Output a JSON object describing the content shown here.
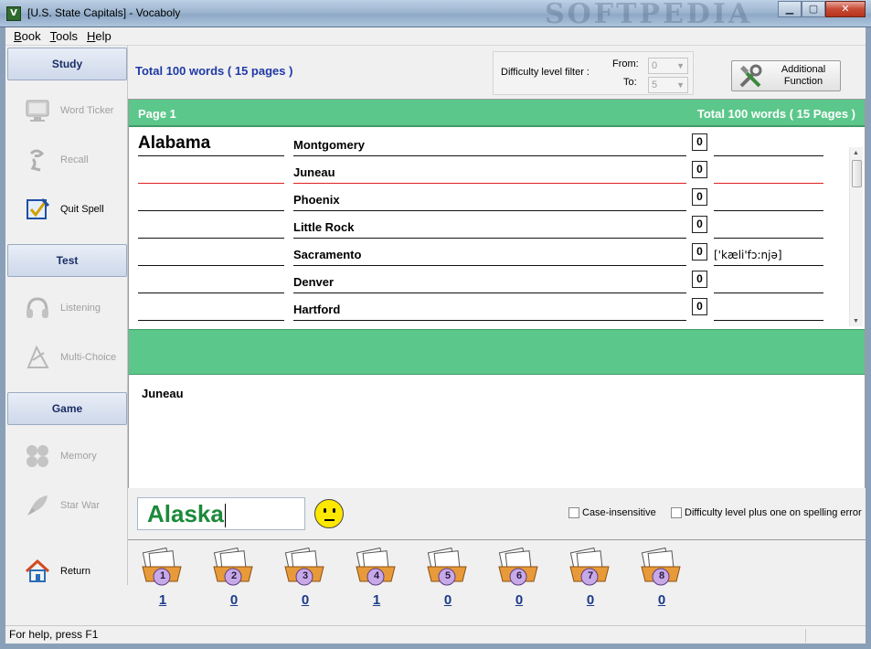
{
  "window": {
    "title": "[U.S. State Capitals] - Vocaboly",
    "watermark": "SOFTPEDIA",
    "controls": [
      "minimize",
      "maximize",
      "close"
    ]
  },
  "menu": [
    "Book",
    "Tools",
    "Help"
  ],
  "sidebar": {
    "study_header": "Study",
    "study_items": [
      {
        "label": "Word Ticker",
        "icon": "monitor-icon",
        "enabled": false
      },
      {
        "label": "Recall",
        "icon": "recall-icon",
        "enabled": false
      },
      {
        "label": "Quit Spell",
        "icon": "spell-icon",
        "enabled": true
      }
    ],
    "test_header": "Test",
    "test_items": [
      {
        "label": "Listening",
        "icon": "headphones-icon",
        "enabled": false
      },
      {
        "label": "Multi-Choice",
        "icon": "multi-choice-icon",
        "enabled": false
      }
    ],
    "game_header": "Game",
    "game_items": [
      {
        "label": "Memory",
        "icon": "memory-icon",
        "enabled": false
      },
      {
        "label": "Star War",
        "icon": "rocket-icon",
        "enabled": false
      }
    ],
    "return_label": "Return"
  },
  "top": {
    "total_words": "Total 100 words ( 15 pages )",
    "filter_label": "Difficulty level filter :",
    "from_label": "From:",
    "from_value": "0",
    "to_label": "To:",
    "to_value": "5",
    "additional_line1": "Additional",
    "additional_line2": "Function"
  },
  "list": {
    "page_label": "Page 1",
    "total_label": "Total 100 words ( 15 Pages )",
    "rows": [
      {
        "word": "Alabama",
        "meaning": "Montgomery",
        "count": "0",
        "phonetic": ""
      },
      {
        "word": "",
        "meaning": "Juneau",
        "count": "0",
        "phonetic": ""
      },
      {
        "word": "",
        "meaning": "Phoenix",
        "count": "0",
        "phonetic": ""
      },
      {
        "word": "",
        "meaning": "Little Rock",
        "count": "0",
        "phonetic": ""
      },
      {
        "word": "",
        "meaning": "Sacramento",
        "count": "0",
        "phonetic": "['kæli'fɔ:njə]"
      },
      {
        "word": "",
        "meaning": "Denver",
        "count": "0",
        "phonetic": ""
      },
      {
        "word": "",
        "meaning": "Hartford",
        "count": "0",
        "phonetic": ""
      }
    ],
    "selected_index": 1
  },
  "detail_text": "Juneau",
  "answer_value": "Alaska",
  "options": {
    "case_insensitive": "Case-insensitive",
    "difficulty_plus": "Difficulty level plus one on spelling error"
  },
  "boxes": [
    {
      "number": "1",
      "count": "1"
    },
    {
      "number": "2",
      "count": "0"
    },
    {
      "number": "3",
      "count": "0"
    },
    {
      "number": "4",
      "count": "1"
    },
    {
      "number": "5",
      "count": "0"
    },
    {
      "number": "6",
      "count": "0"
    },
    {
      "number": "7",
      "count": "0"
    },
    {
      "number": "8",
      "count": "0"
    }
  ],
  "status": "For help, press F1",
  "colors": {
    "accent_green": "#5cc78b",
    "link_blue": "#1f3aa6",
    "answer_green": "#1c8a3a"
  }
}
